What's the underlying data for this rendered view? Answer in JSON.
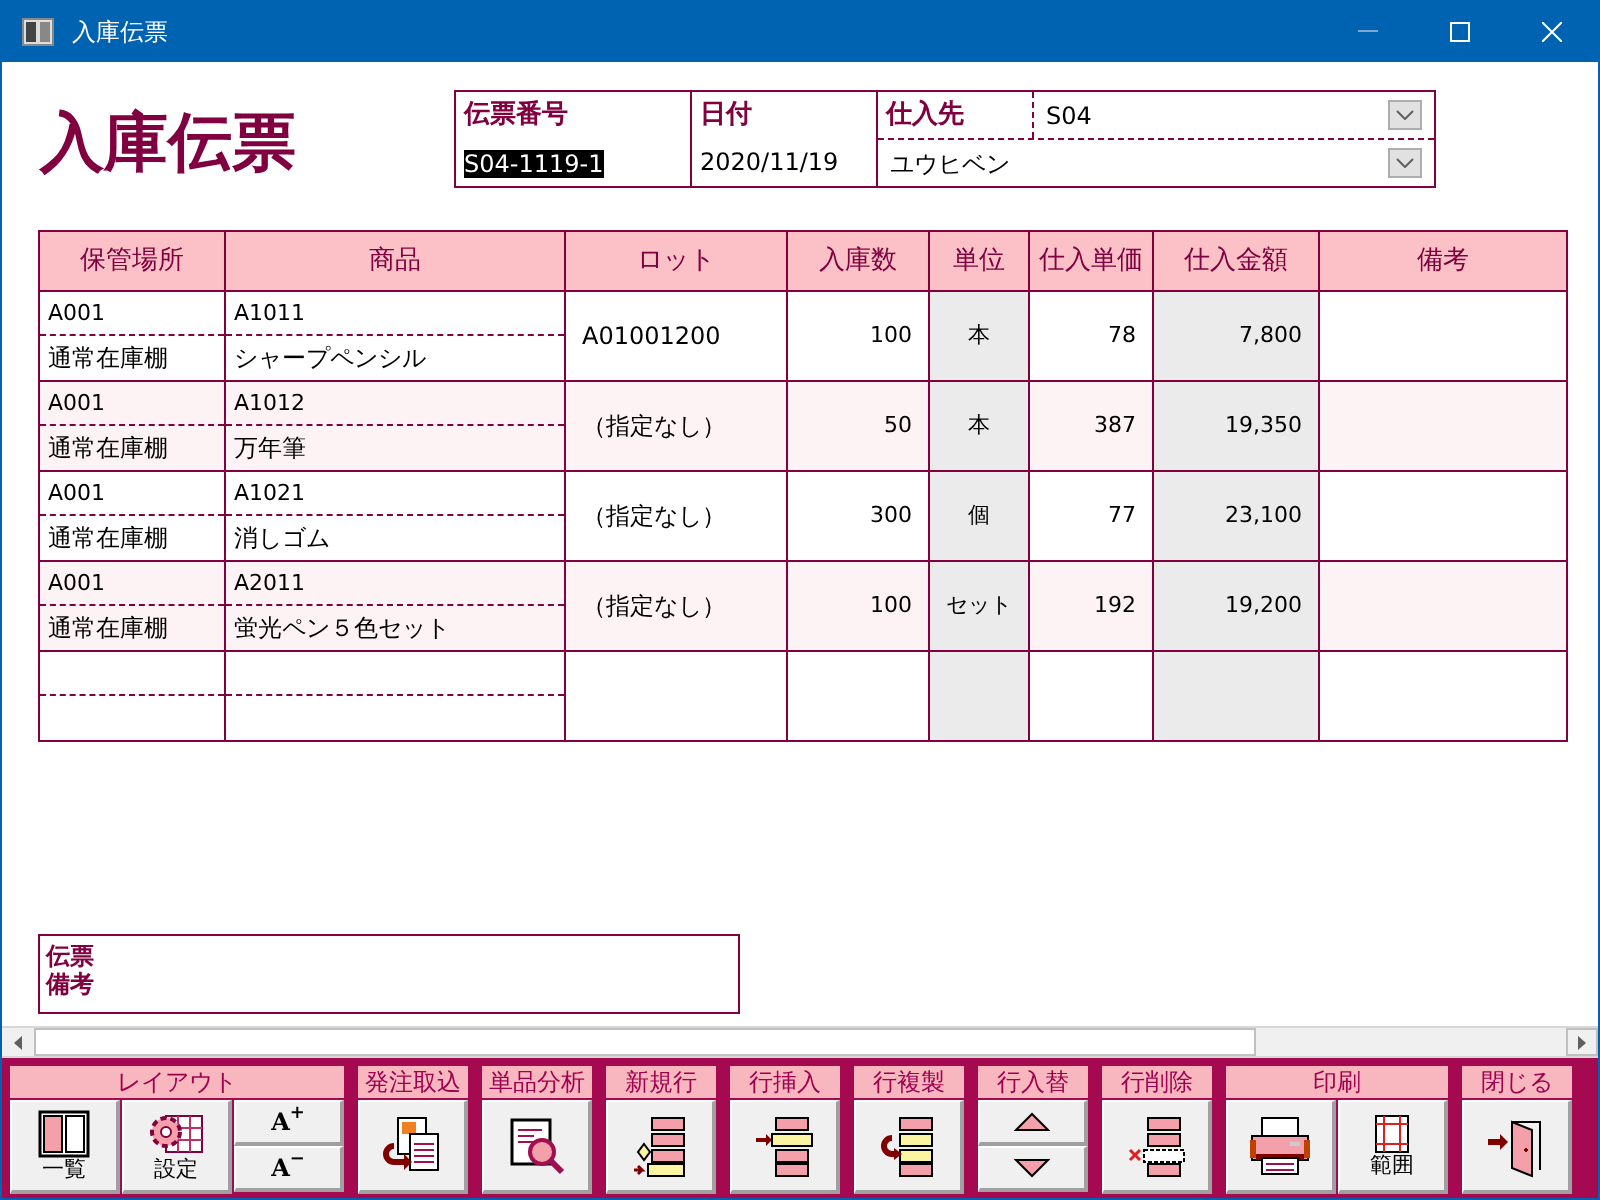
{
  "window": {
    "title": "入庫伝票"
  },
  "heading": "入庫伝票",
  "header": {
    "slip_number": {
      "label": "伝票番号",
      "value": "S04-1119-1",
      "value_selected": true
    },
    "date": {
      "label": "日付",
      "value": "2020/11/19"
    },
    "supplier": {
      "label": "仕入先",
      "code": "S04",
      "name": "ユウヒベン"
    }
  },
  "table": {
    "columns": [
      "保管場所",
      "商品",
      "ロット",
      "入庫数",
      "単位",
      "仕入単価",
      "仕入金額",
      "備考"
    ],
    "rows": [
      {
        "location_code": "A001",
        "location_name": "通常在庫棚",
        "product_code": "A1011",
        "product_name": "シャープペンシル",
        "lot": "A01001200",
        "quantity": "100",
        "unit": "本",
        "unit_price": "78",
        "amount": "7,800"
      },
      {
        "location_code": "A001",
        "location_name": "通常在庫棚",
        "product_code": "A1012",
        "product_name": "万年筆",
        "lot": "（指定なし）",
        "quantity": "50",
        "unit": "本",
        "unit_price": "387",
        "amount": "19,350"
      },
      {
        "location_code": "A001",
        "location_name": "通常在庫棚",
        "product_code": "A1021",
        "product_name": "消しゴム",
        "lot": "（指定なし）",
        "quantity": "300",
        "unit": "個",
        "unit_price": "77",
        "amount": "23,100"
      },
      {
        "location_code": "A001",
        "location_name": "通常在庫棚",
        "product_code": "A2011",
        "product_name": "蛍光ペン５色セット",
        "lot": "（指定なし）",
        "quantity": "100",
        "unit": "セット",
        "unit_price": "192",
        "amount": "19,200"
      }
    ]
  },
  "slip_note": {
    "label_lines": [
      "伝票",
      "備考"
    ]
  },
  "toolbar": [
    {
      "title": "レイアウト",
      "buttons": [
        {
          "kind": "list",
          "label": "一覧"
        },
        {
          "kind": "settings",
          "label": "設定"
        },
        {
          "kind": "stack",
          "items": [
            {
              "kind": "text",
              "label": "A$^{+}$"
            },
            {
              "kind": "text",
              "label": "A$^{−}$"
            }
          ]
        }
      ]
    },
    {
      "title": "発注取込",
      "buttons": [
        {
          "kind": "import"
        }
      ]
    },
    {
      "title": "単品分析",
      "buttons": [
        {
          "kind": "analyze"
        }
      ]
    },
    {
      "title": "新規行",
      "buttons": [
        {
          "kind": "new-row"
        }
      ]
    },
    {
      "title": "行挿入",
      "buttons": [
        {
          "kind": "insert-row"
        }
      ]
    },
    {
      "title": "行複製",
      "buttons": [
        {
          "kind": "copy-row"
        }
      ]
    },
    {
      "title": "行入替",
      "buttons": [
        {
          "kind": "stack",
          "items": [
            {
              "kind": "up"
            },
            {
              "kind": "down"
            }
          ]
        }
      ]
    },
    {
      "title": "行削除",
      "buttons": [
        {
          "kind": "delete-row"
        }
      ]
    },
    {
      "title": "印刷",
      "buttons": [
        {
          "kind": "print"
        },
        {
          "kind": "print-range",
          "label": "範囲"
        }
      ]
    },
    {
      "title": "閉じる",
      "buttons": [
        {
          "kind": "exit"
        }
      ]
    }
  ]
}
